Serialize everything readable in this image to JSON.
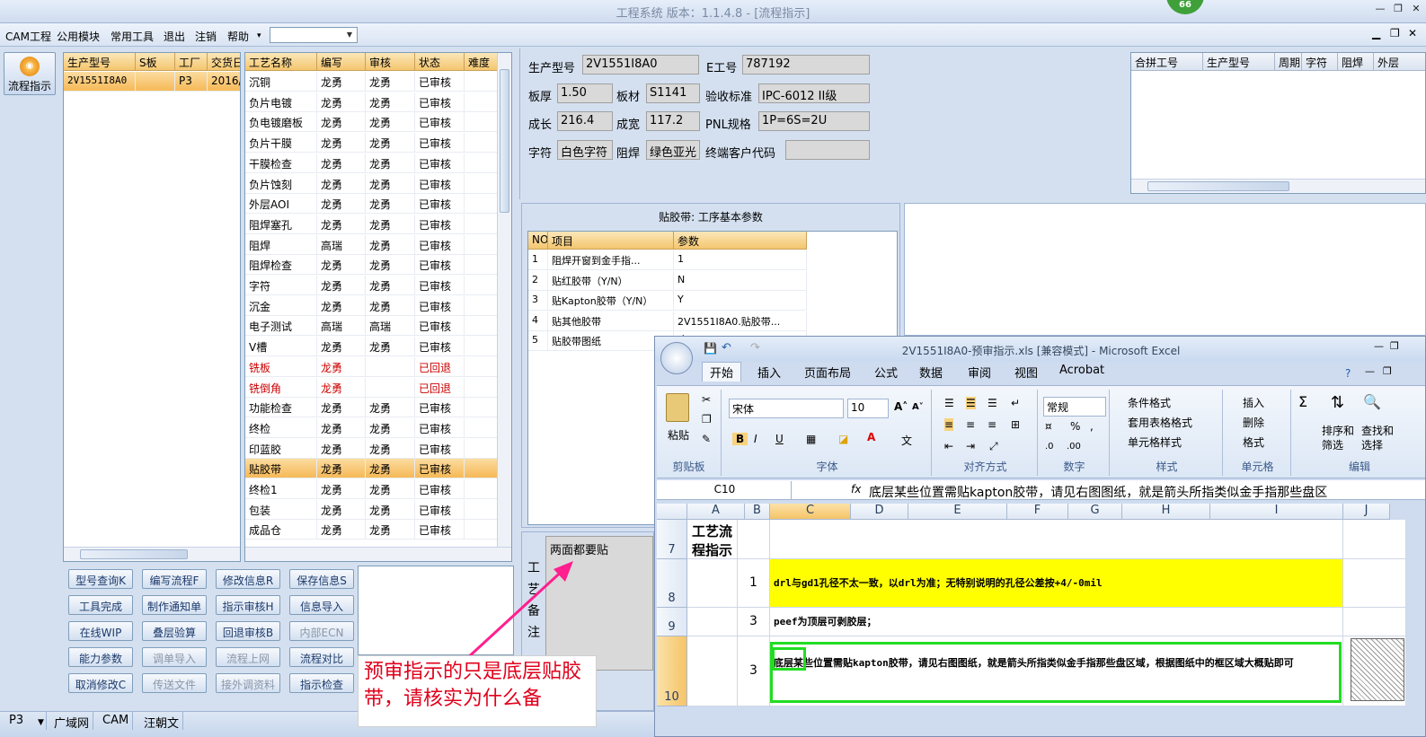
{
  "window": {
    "title": "工程系统   版本：1.1.4.8 - [流程指示]",
    "badge": "66"
  },
  "menu": [
    "CAM工程",
    "公用模块",
    "常用工具",
    "退出",
    "注销",
    "帮助"
  ],
  "menu_dropdown": "▾",
  "left_nav": {
    "flow_button": "流程指示"
  },
  "orders": {
    "headers": [
      "生产型号",
      "S板",
      "工厂",
      "交货日"
    ],
    "rows": [
      [
        "2V1551I8A0",
        "",
        "P3",
        "2016/"
      ]
    ]
  },
  "process": {
    "headers": [
      "工艺名称",
      "编写",
      "审核",
      "状态",
      "难度"
    ],
    "rows": [
      [
        "沉铜",
        "龙勇",
        "龙勇",
        "已审核",
        ""
      ],
      [
        "负片电镀",
        "龙勇",
        "龙勇",
        "已审核",
        ""
      ],
      [
        "负电镀磨板",
        "龙勇",
        "龙勇",
        "已审核",
        ""
      ],
      [
        "负片干膜",
        "龙勇",
        "龙勇",
        "已审核",
        ""
      ],
      [
        "干膜检查",
        "龙勇",
        "龙勇",
        "已审核",
        ""
      ],
      [
        "负片蚀刻",
        "龙勇",
        "龙勇",
        "已审核",
        ""
      ],
      [
        "外层AOI",
        "龙勇",
        "龙勇",
        "已审核",
        ""
      ],
      [
        "阻焊塞孔",
        "龙勇",
        "龙勇",
        "已审核",
        ""
      ],
      [
        "阻焊",
        "高瑞",
        "龙勇",
        "已审核",
        ""
      ],
      [
        "阻焊检查",
        "龙勇",
        "龙勇",
        "已审核",
        ""
      ],
      [
        "字符",
        "龙勇",
        "龙勇",
        "已审核",
        ""
      ],
      [
        "沉金",
        "龙勇",
        "龙勇",
        "已审核",
        ""
      ],
      [
        "电子测试",
        "高瑞",
        "高瑞",
        "已审核",
        ""
      ],
      [
        "V槽",
        "龙勇",
        "龙勇",
        "已审核",
        ""
      ],
      [
        "铣板",
        "龙勇",
        "",
        "已回退",
        ""
      ],
      [
        "铣倒角",
        "龙勇",
        "",
        "已回退",
        ""
      ],
      [
        "功能检查",
        "龙勇",
        "龙勇",
        "已审核",
        ""
      ],
      [
        "终检",
        "龙勇",
        "龙勇",
        "已审核",
        ""
      ],
      [
        "印蓝胶",
        "龙勇",
        "龙勇",
        "已审核",
        ""
      ],
      [
        "贴胶带",
        "龙勇",
        "龙勇",
        "已审核",
        ""
      ],
      [
        "终检1",
        "龙勇",
        "龙勇",
        "已审核",
        ""
      ],
      [
        "包装",
        "龙勇",
        "龙勇",
        "已审核",
        ""
      ],
      [
        "成品仓",
        "龙勇",
        "龙勇",
        "已审核",
        ""
      ]
    ],
    "returned_rows": [
      14,
      15
    ],
    "selected_row": 19
  },
  "buttons": [
    [
      "型号查询K",
      "编写流程F",
      "修改信息R",
      "保存信息S"
    ],
    [
      "工具完成",
      "制作通知单",
      "指示审核H",
      "信息导入"
    ],
    [
      "在线WIP",
      "叠层验算",
      "回退审核B",
      "内部ECN"
    ],
    [
      "能力参数",
      "调单导入",
      "流程上网",
      "流程对比"
    ],
    [
      "取消修改C",
      "传送文件",
      "接外调资料",
      "指示检查"
    ]
  ],
  "disabled_buttons": [
    "内部ECN",
    "调单导入",
    "流程上网",
    "传送文件",
    "接外调资料"
  ],
  "info": {
    "model_label": "生产型号",
    "model": "2V1551I8A0",
    "e_label": "E工号",
    "e_no": "787192",
    "thick_label": "板厚",
    "thick": "1.50",
    "mat_label": "板材",
    "mat": "S1141",
    "std_label": "验收标准",
    "std": "IPC-6012 II级",
    "len_label": "成长",
    "len": "216.4",
    "wid_label": "成宽",
    "wid": "117.2",
    "pnl_label": "PNL规格",
    "pnl": "1P=6S=2U",
    "char_label": "字符",
    "char": "白色字符",
    "mask_label": "阻焊",
    "mask": "绿色亚光",
    "cust_label": "终端客户代码",
    "cust": ""
  },
  "combine": {
    "headers": [
      "合拼工号",
      "生产型号",
      "周期",
      "字符",
      "阻焊",
      "外层"
    ]
  },
  "params": {
    "title": "贴胶带: 工序基本参数",
    "headers": [
      "NO",
      "项目",
      "参数"
    ],
    "rows": [
      [
        "1",
        "阻焊开窗到金手指...",
        "1"
      ],
      [
        "2",
        "贴红胶带（Y/N）",
        "N"
      ],
      [
        "3",
        "贴Kapton胶带（Y/N）",
        "Y"
      ],
      [
        "4",
        "贴其他胶带",
        "2V1551I8A0.贴胶带..."
      ],
      [
        "5",
        "贴胶带图纸",
        "√"
      ]
    ]
  },
  "note": {
    "label": "工艺备注",
    "text": "两面都要贴"
  },
  "status_tabs": [
    "P3",
    "广域网",
    "CAM",
    "汪朝文"
  ],
  "excel": {
    "title": "2V1551I8A0-预审指示.xls  [兼容模式] - Microsoft Excel",
    "tabs": [
      "开始",
      "插入",
      "页面布局",
      "公式",
      "数据",
      "审阅",
      "视图",
      "Acrobat"
    ],
    "groups": [
      "剪贴板",
      "字体",
      "对齐方式",
      "数字",
      "样式",
      "单元格",
      "编辑"
    ],
    "paste": "粘贴",
    "font": "宋体",
    "size": "10",
    "numfmt": "常规",
    "style_items": [
      "条件格式",
      "套用表格格式",
      "单元格样式"
    ],
    "cell_items": [
      "插入",
      "删除",
      "格式"
    ],
    "edit_items": [
      "排序和筛选",
      "查找和选择"
    ],
    "name_box": "C10",
    "formula": "底层某些位置需贴kapton胶带，请见右图图纸，就是箭头所指类似金手指那些盘区",
    "columns": [
      "A",
      "B",
      "C",
      "D",
      "E",
      "F",
      "G",
      "H",
      "I",
      "J"
    ],
    "rows": [
      {
        "n": "7",
        "a": "工艺流程指示",
        "b": "",
        "c": ""
      },
      {
        "n": "8",
        "a": "",
        "b": "1",
        "c": "drl与gd1孔径不太一致，以drl为准；无特别说明的孔径公差按+4/-0mil"
      },
      {
        "n": "9",
        "a": "",
        "b": "3",
        "c": "peef为顶层可剥胶层；"
      },
      {
        "n": "10",
        "a": "",
        "b": "3",
        "c": "底层某些位置需贴kapton胶带，请见右图图纸，就是箭头所指类似金手指那些盘区域，根据图纸中的框区域大概贴即可"
      }
    ],
    "highlight_color": "#ffff00",
    "box_color": "#22dd22"
  },
  "callout": "预审指示的只是底层贴胶带，请核实为什么备",
  "arrow_color": "#ff1f8e"
}
